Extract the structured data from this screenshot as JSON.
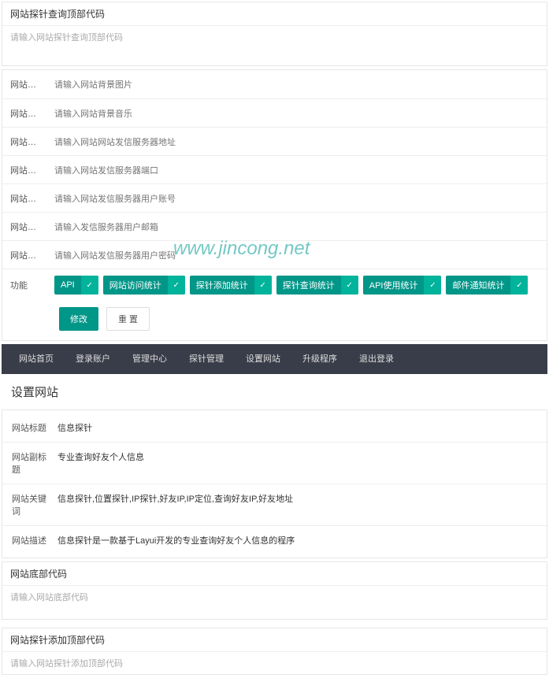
{
  "topSection": {
    "title": "网站探针查询顶部代码",
    "placeholder": "请输入网站探针查询顶部代码"
  },
  "fields": {
    "bgImage": {
      "label": "网站背景...",
      "placeholder": "请输入网站背景图片"
    },
    "bgMusic": {
      "label": "网站背景...",
      "placeholder": "请输入网站背景音乐"
    },
    "sendServer": {
      "label": "网站发信...",
      "placeholder": "请输入网站网站发信服务器地址"
    },
    "sendPort": {
      "label": "网站发信...",
      "placeholder": "请输入网站发信服务器端口"
    },
    "sendUser": {
      "label": "网站发信...",
      "placeholder": "请输入网站发信服务器用户账号"
    },
    "sendMail": {
      "label": "网站发信...",
      "placeholder": "请输入发信服务器用户邮箱"
    },
    "sendPwd": {
      "label": "网站发信...",
      "placeholder": "请输入网站发信服务器用户密码"
    }
  },
  "features": {
    "label": "功能",
    "items": [
      "API",
      "网站访问统计",
      "探针添加统计",
      "探针查询统计",
      "API使用统计",
      "邮件通知统计"
    ]
  },
  "buttons": {
    "submit": "修改",
    "reset": "重 置"
  },
  "nav": [
    "网站首页",
    "登录账户",
    "管理中心",
    "探针管理",
    "设置网站",
    "升级程序",
    "退出登录"
  ],
  "pageTitle": "设置网站",
  "info": {
    "siteTitle": {
      "label": "网站标题",
      "value": "信息探针"
    },
    "siteSubTitle": {
      "label": "网站副标题",
      "value": "专业查询好友个人信息"
    },
    "siteKeywords": {
      "label": "网站关键词",
      "value": "信息探针,位置探针,IP探针,好友IP,IP定位,查询好友IP,好友地址"
    },
    "siteDesc": {
      "label": "网站描述",
      "value": "信息探针是一款基于Layui开发的专业查询好友个人信息的程序"
    }
  },
  "bottomCode": {
    "title": "网站底部代码",
    "placeholder": "请输入网站底部代码"
  },
  "addTopCode": {
    "title": "网站探针添加顶部代码",
    "placeholder": "请输入网站探针添加顶部代码"
  },
  "watermark": "www.jincong.net"
}
